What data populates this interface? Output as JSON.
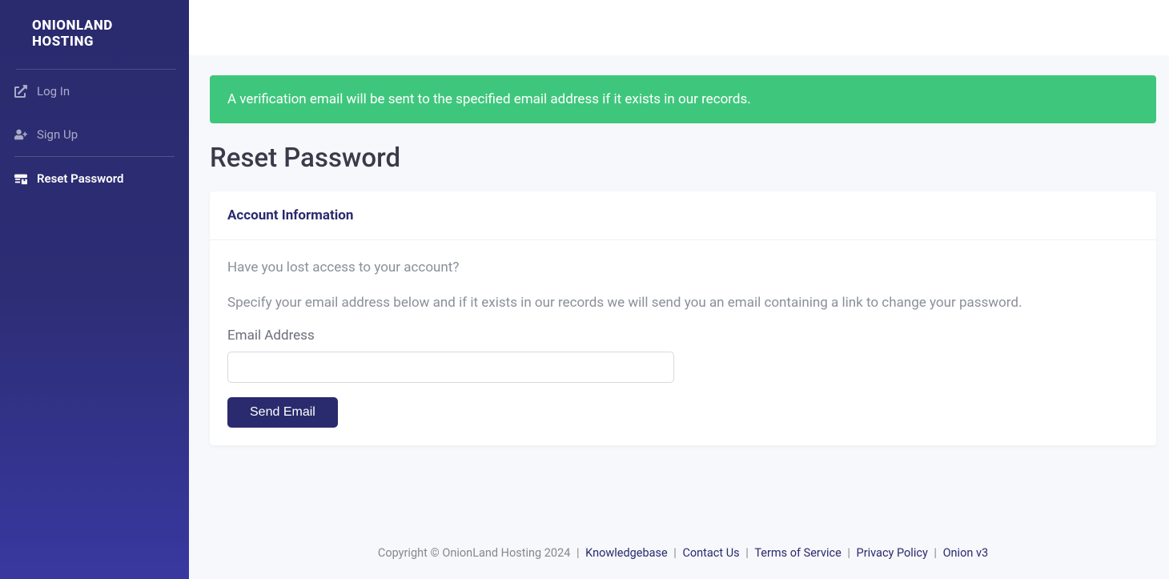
{
  "brand": "ONIONLAND HOSTING",
  "sidebar": {
    "items": [
      {
        "label": "Log In",
        "icon": "external-link-icon",
        "active": false
      },
      {
        "label": "Sign Up",
        "icon": "user-plus-icon",
        "active": false
      },
      {
        "label": "Reset Password",
        "icon": "server-icon",
        "active": true
      }
    ]
  },
  "alert": {
    "message": "A verification email will be sent to the specified email address if it exists in our records."
  },
  "page": {
    "title": "Reset Password",
    "card_title": "Account Information",
    "para1": "Have you lost access to your account?",
    "para2": "Specify your email address below and if it exists in our records we will send you an email containing a link to change your password.",
    "email_label": "Email Address",
    "email_value": "",
    "submit_label": "Send Email"
  },
  "footer": {
    "copyright": "Copyright © OnionLand Hosting 2024",
    "links": [
      "Knowledgebase",
      "Contact Us",
      "Terms of Service",
      "Privacy Policy",
      "Onion v3"
    ]
  }
}
